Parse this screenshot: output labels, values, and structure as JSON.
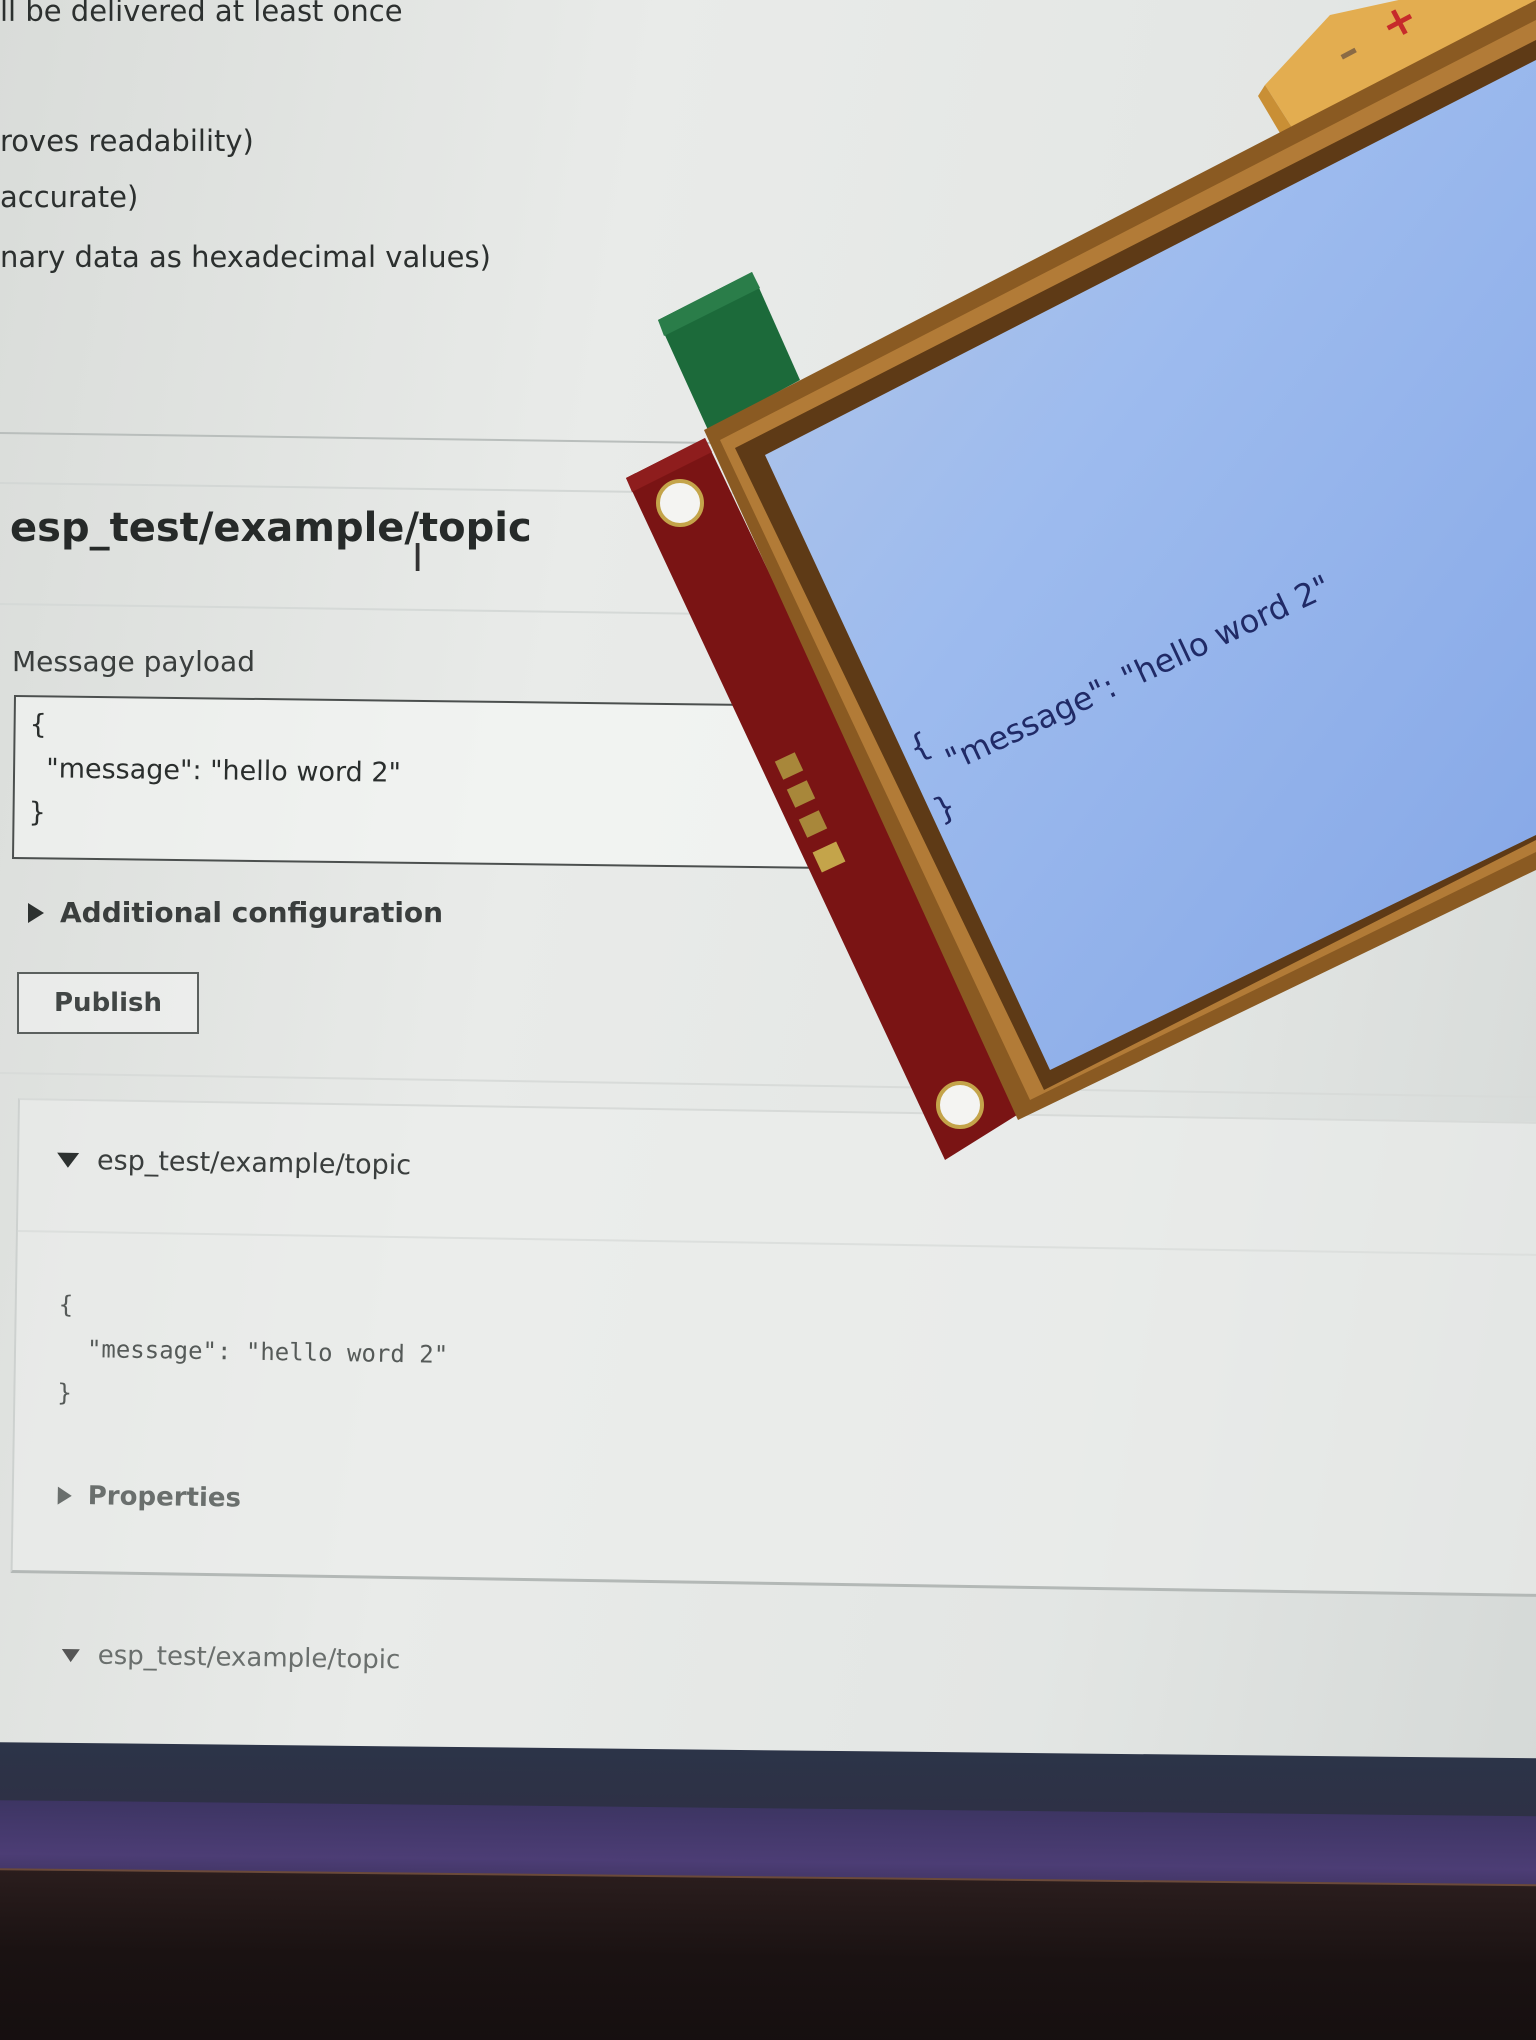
{
  "qos_options": {
    "line_1": "ll be delivered at least once",
    "line_2": "roves readability)",
    "line_3": " accurate)",
    "line_4": "nary data as hexadecimal values)"
  },
  "publish_section": {
    "topic_name": "esp_test/example/topic",
    "payload_label": "Message payload",
    "payload_lines": [
      "{",
      "  \"message\": \"hello word 2\"",
      "}"
    ],
    "additional_config_label": "Additional configuration",
    "publish_button_label": "Publish"
  },
  "messages": [
    {
      "topic": "esp_test/example/topic",
      "body_lines": [
        "{",
        "  \"message\": \"hello word 2\"",
        "}"
      ],
      "properties_label": "Properties"
    },
    {
      "topic": "esp_test/example/topic"
    }
  ],
  "display_module": {
    "screen_lines": [
      "{",
      "\"message\": \"hello word 2\"",
      "}"
    ],
    "button_minus": "–",
    "button_plus": "+",
    "colors": {
      "pcb": "#7a1414",
      "screen": "#8fb0e8",
      "frame": "#8a5a22",
      "connector": "#1c6a3a",
      "button_housing": "#e0a94a"
    }
  }
}
